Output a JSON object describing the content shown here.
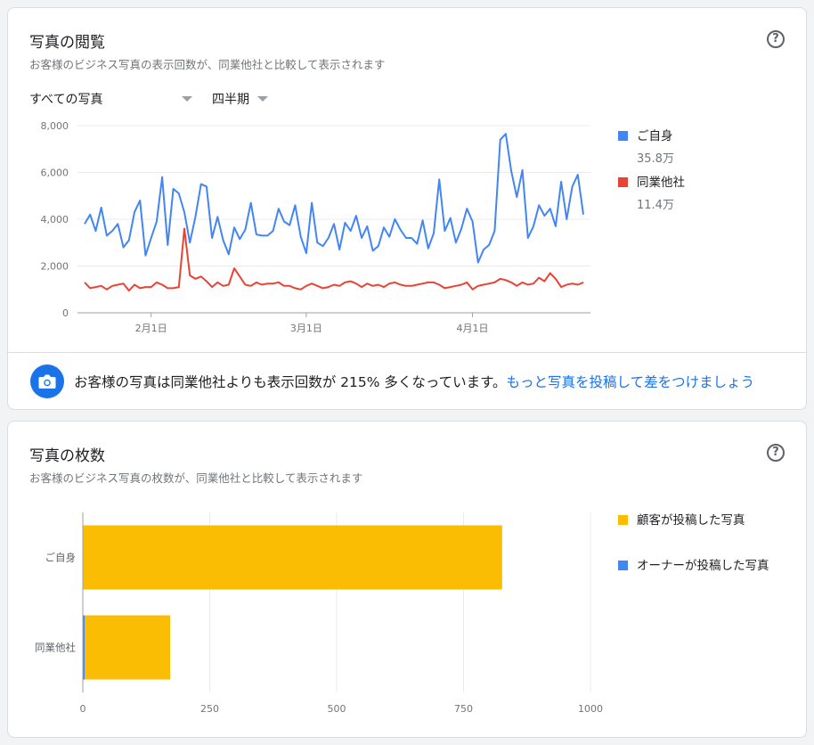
{
  "views_card": {
    "title": "写真の閲覧",
    "subtitle": "お客様のビジネス写真の表示回数が、同業他社と比較して表示されます",
    "filter_photos": "すべての写真",
    "filter_period": "四半期",
    "legend": [
      {
        "label": "ご自身",
        "value": "35.8万",
        "color": "#4285f4"
      },
      {
        "label": "同業他社",
        "value": "11.4万",
        "color": "#ea4335"
      }
    ],
    "insight_text": "お客様の写真は同業他社よりも表示回数が 215% 多くなっています。",
    "insight_link": "もっと写真を投稿して差をつけましょう",
    "help_icon": "question-circle-icon",
    "camera_icon": "camera-icon"
  },
  "count_card": {
    "title": "写真の枚数",
    "subtitle": "お客様のビジネス写真の枚数が、同業他社と比較して表示されます",
    "help_icon": "question-circle-icon",
    "legend": [
      {
        "label": "顧客が投稿した写真",
        "color": "#fbbc04"
      },
      {
        "label": "オーナーが投稿した写真",
        "color": "#4285f4"
      }
    ]
  },
  "chart_data": [
    {
      "type": "line",
      "yticks": [
        "8,000",
        "6,000",
        "4,000",
        "2,000",
        "0"
      ],
      "ylim": [
        0,
        8000
      ],
      "xticks": [
        "2月1日",
        "3月1日",
        "4月1日"
      ],
      "xtick_index": [
        12,
        40,
        70
      ],
      "grid": true,
      "series": [
        {
          "name": "ご自身",
          "color": "#4285f4",
          "values": [
            3800,
            4200,
            3500,
            4500,
            3300,
            3500,
            3800,
            2800,
            3100,
            4300,
            4800,
            2450,
            3200,
            3900,
            5800,
            2900,
            5300,
            5100,
            4300,
            3000,
            4100,
            5500,
            5400,
            3200,
            4100,
            3100,
            2500,
            3650,
            3150,
            3550,
            4700,
            3350,
            3300,
            3300,
            3500,
            4450,
            3900,
            3750,
            4600,
            3250,
            2550,
            4700,
            3000,
            2850,
            3200,
            3800,
            2700,
            3850,
            3500,
            4150,
            3200,
            3700,
            2650,
            2850,
            3650,
            3250,
            4000,
            3550,
            3200,
            3200,
            2950,
            3950,
            2750,
            3400,
            5700,
            3500,
            4050,
            3000,
            3600,
            4450,
            3900,
            2150,
            2700,
            2900,
            3500,
            7400,
            7650,
            6050,
            4950,
            6100,
            3200,
            3700,
            4600,
            4150,
            4450,
            3700,
            5600,
            4000,
            5400,
            5900,
            4200
          ]
        },
        {
          "name": "同業他社",
          "color": "#ea4335",
          "values": [
            1300,
            1050,
            1100,
            1150,
            1000,
            1150,
            1200,
            1250,
            950,
            1200,
            1050,
            1100,
            1100,
            1300,
            1200,
            1050,
            1050,
            1100,
            3600,
            1600,
            1450,
            1550,
            1350,
            1100,
            1300,
            1150,
            1200,
            1900,
            1550,
            1200,
            1150,
            1300,
            1200,
            1250,
            1250,
            1300,
            1150,
            1150,
            1050,
            1000,
            1150,
            1250,
            1150,
            1050,
            1100,
            1200,
            1150,
            1300,
            1350,
            1250,
            1100,
            1250,
            1150,
            1200,
            1100,
            1250,
            1300,
            1200,
            1150,
            1150,
            1200,
            1250,
            1300,
            1300,
            1200,
            1050,
            1100,
            1150,
            1200,
            1300,
            1000,
            1150,
            1200,
            1250,
            1300,
            1450,
            1400,
            1300,
            1150,
            1300,
            1200,
            1250,
            1500,
            1350,
            1700,
            1450,
            1100,
            1200,
            1250,
            1200,
            1300
          ]
        }
      ]
    },
    {
      "type": "bar",
      "orientation": "horizontal",
      "stacked": true,
      "categories": [
        "ご自身",
        "同業他社"
      ],
      "xticks": [
        "0",
        "250",
        "500",
        "750",
        "1000"
      ],
      "xlim": [
        0,
        1000
      ],
      "grid": true,
      "series": [
        {
          "name": "オーナーが投稿した写真",
          "color": "#4285f4",
          "values": [
            0,
            4
          ]
        },
        {
          "name": "顧客が投稿した写真",
          "color": "#fbbc04",
          "values": [
            826,
            168
          ]
        }
      ]
    }
  ]
}
